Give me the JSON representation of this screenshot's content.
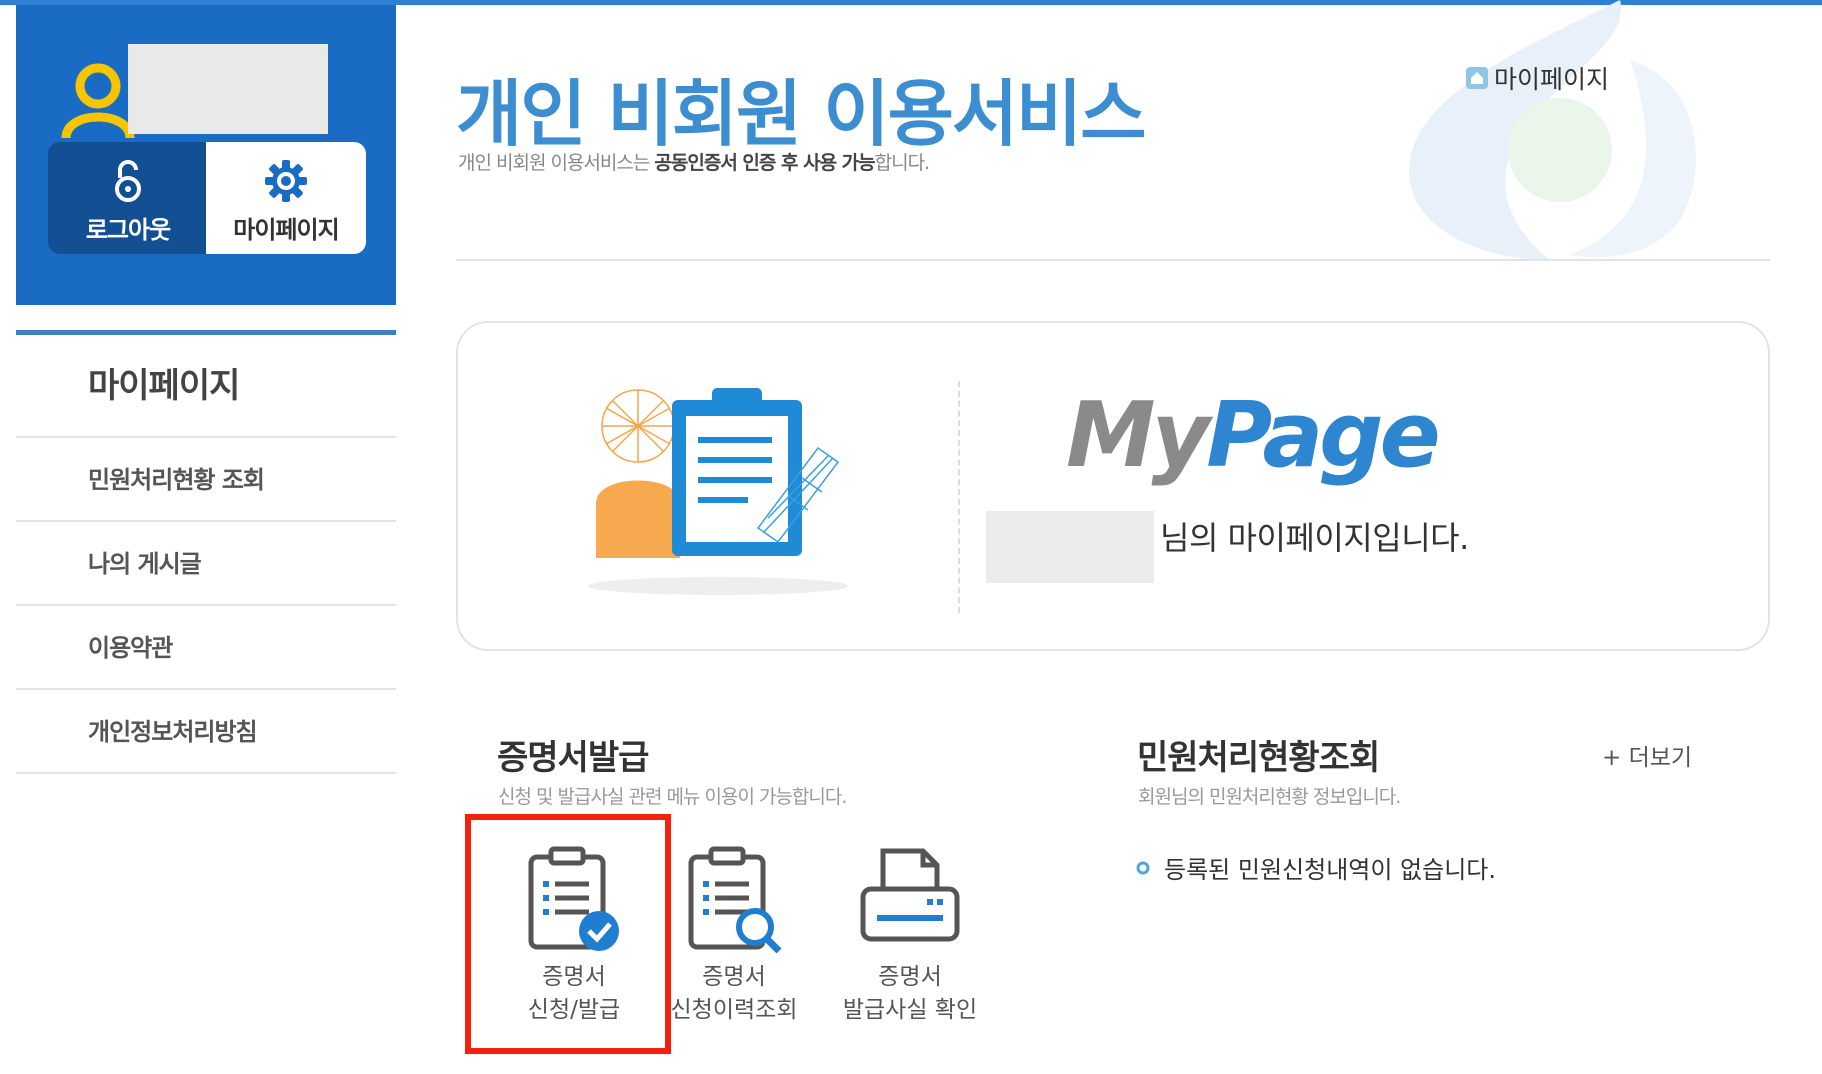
{
  "sidebar": {
    "logout_label": "로그아웃",
    "mypage_label": "마이페이지",
    "menu_title": "마이페이지",
    "items": [
      {
        "label": "민원처리현황 조회"
      },
      {
        "label": "나의 게시글"
      },
      {
        "label": "이용약관"
      },
      {
        "label": "개인정보처리방침"
      }
    ]
  },
  "header": {
    "title": "개인 비회원 이용서비스",
    "subtitle_pre": "개인 비회원 이용서비스는 ",
    "subtitle_bold": "공동인증서 인증 후 사용 가능",
    "subtitle_post": "합니다.",
    "breadcrumb": "마이페이지"
  },
  "banner": {
    "logo_my": "My",
    "logo_page": "Page",
    "welcome": "님의 마이페이지입니다."
  },
  "certificate": {
    "title": "증명서발급",
    "desc": "신청 및 발급사실 관련 메뉴 이용이 가능합니다.",
    "items": [
      {
        "line1": "증명서",
        "line2": "신청/발급",
        "icon": "clipboard-check-icon"
      },
      {
        "line1": "증명서",
        "line2": "신청이력조회",
        "icon": "clipboard-search-icon"
      },
      {
        "line1": "증명서",
        "line2": "발급사실 확인",
        "icon": "printer-icon"
      }
    ]
  },
  "status": {
    "title": "민원처리현황조회",
    "desc": "회원님의 민원처리현황 정보입니다.",
    "more_label": "+ 더보기",
    "empty": "등록된 민원신청내역이 없습니다."
  },
  "colors": {
    "brand_blue": "#1a6bc3",
    "dark_blue": "#124f93",
    "title_blue": "#3d8ed0",
    "highlight_red": "#f5200c",
    "user_icon_yellow": "#f5c500"
  }
}
